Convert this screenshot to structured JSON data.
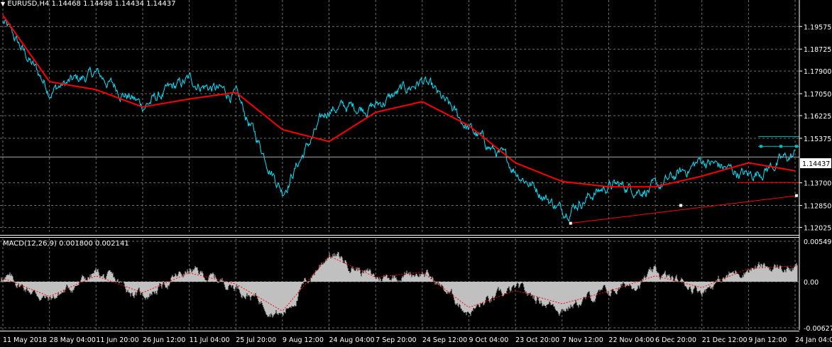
{
  "symbol_header": "EURUSD,H4  1.14468 1.14498 1.14434 1.14437",
  "macd_header": "MACD(12,26,9) 0.001800 0.002141",
  "current_price_label": "1.14437",
  "colors": {
    "background": "#000000",
    "price": "#00e5ff",
    "moving_average": "#ff0000",
    "macd_hist": "#c0c0c0",
    "macd_signal": "#ff0000",
    "grid": "#6e6e6e",
    "trendline": "#ff0000",
    "hline_marker": "#00c0c0"
  },
  "chart_data": [
    {
      "type": "line",
      "title": "EURUSD,H4",
      "quote": {
        "open": 1.14468,
        "high": 1.14498,
        "low": 1.14434,
        "close": 1.14437
      },
      "price_ticks": [
        "1.19575",
        "1.18725",
        "1.17900",
        "1.17050",
        "1.16225",
        "1.15375",
        "1.14437",
        "1.13700",
        "1.12850",
        "1.12025"
      ],
      "ylim": [
        1.1185,
        1.2025
      ],
      "time_ticks": [
        "11 May 2018",
        "28 May 04:00",
        "11 Jun 20:00",
        "26 Jun 12:00",
        "11 Jul 04:00",
        "25 Jul 20:00",
        "9 Aug 12:00",
        "24 Aug 04:00",
        "7 Sep 20:00",
        "24 Sep 12:00",
        "9 Oct 04:00",
        "23 Oct 20:00",
        "7 Nov 12:00",
        "22 Nov 04:00",
        "6 Dec 20:00",
        "21 Dec 12:00",
        "9 Jan 12:00",
        "24 Jan 04:00"
      ],
      "series": [
        {
          "x": [
            "11 May 2018",
            "28 May 04:00",
            "11 Jun 20:00",
            "26 Jun 12:00",
            "11 Jul 04:00",
            "25 Jul 20:00",
            "9 Aug 12:00",
            "24 Aug 04:00",
            "7 Sep 20:00",
            "24 Sep 12:00",
            "9 Oct 04:00",
            "23 Oct 20:00",
            "7 Nov 12:00",
            "22 Nov 04:00",
            "6 Dec 20:00",
            "21 Dec 12:00",
            "9 Jan 12:00",
            "24 Jan 04:00"
          ],
          "values": [
            1.1975,
            1.172,
            1.178,
            1.166,
            1.1755,
            1.1695,
            1.134,
            1.165,
            1.166,
            1.1755,
            1.1575,
            1.142,
            1.1265,
            1.136,
            1.1345,
            1.1455,
            1.1395,
            1.1475
          ]
        },
        {
          "x": [
            "11 May 2018",
            "28 May 04:00",
            "11 Jun 20:00",
            "26 Jun 12:00",
            "11 Jul 04:00",
            "25 Jul 20:00",
            "9 Aug 12:00",
            "24 Aug 04:00",
            "7 Sep 20:00",
            "24 Sep 12:00",
            "9 Oct 04:00",
            "23 Oct 20:00",
            "7 Nov 12:00",
            "22 Nov 04:00",
            "6 Dec 20:00",
            "21 Dec 12:00",
            "9 Jan 12:00",
            "24 Jan 04:00"
          ],
          "values": [
            1.2,
            1.175,
            1.172,
            1.1655,
            1.1685,
            1.171,
            1.157,
            1.1525,
            1.1635,
            1.1675,
            1.1585,
            1.1445,
            1.1375,
            1.1355,
            1.1355,
            1.1395,
            1.1445,
            1.1415
          ]
        }
      ],
      "trendline": {
        "from": {
          "x": "7 Nov 12:00",
          "y": 1.1218
        },
        "to": {
          "x": "24 Jan 04:00",
          "y": 1.1322
        }
      },
      "horizontal_lines": [
        1.1467,
        1.1507,
        1.1544,
        1.1371
      ]
    },
    {
      "type": "area",
      "title": "MACD(12,26,9)",
      "macd": 0.0018,
      "signal": 0.002141,
      "y_ticks": [
        "0.005499",
        "0.00",
        "-0.006272"
      ],
      "ylim": [
        -0.006272,
        0.005499
      ],
      "series": [
        {
          "x": [
            "11 May 2018",
            "28 May 04:00",
            "11 Jun 20:00",
            "26 Jun 12:00",
            "11 Jul 04:00",
            "25 Jul 20:00",
            "9 Aug 12:00",
            "24 Aug 04:00",
            "7 Sep 20:00",
            "24 Sep 12:00",
            "9 Oct 04:00",
            "23 Oct 20:00",
            "7 Nov 12:00",
            "22 Nov 04:00",
            "6 Dec 20:00",
            "21 Dec 12:00",
            "9 Jan 12:00",
            "24 Jan 04:00"
          ],
          "values": [
            0.0008,
            -0.0025,
            0.0012,
            -0.002,
            0.0015,
            -0.0005,
            -0.0045,
            0.004,
            0.0005,
            0.0015,
            -0.004,
            -0.0012,
            -0.0035,
            -0.0015,
            0.001,
            -0.001,
            0.002,
            0.0018
          ]
        },
        {
          "x": [
            "11 May 2018",
            "28 May 04:00",
            "11 Jun 20:00",
            "26 Jun 12:00",
            "11 Jul 04:00",
            "25 Jul 20:00",
            "9 Aug 12:00",
            "24 Aug 04:00",
            "7 Sep 20:00",
            "24 Sep 12:00",
            "9 Oct 04:00",
            "23 Oct 20:00",
            "7 Nov 12:00",
            "22 Nov 04:00",
            "6 Dec 20:00",
            "21 Dec 12:00",
            "9 Jan 12:00",
            "24 Jan 04:00"
          ],
          "values": [
            0.0005,
            -0.002,
            0.0008,
            -0.0015,
            0.0012,
            -0.0003,
            -0.004,
            0.0035,
            0.0006,
            0.0013,
            -0.0035,
            -0.0012,
            -0.003,
            -0.0013,
            0.0008,
            -0.0008,
            0.0018,
            0.002141
          ]
        }
      ]
    }
  ]
}
